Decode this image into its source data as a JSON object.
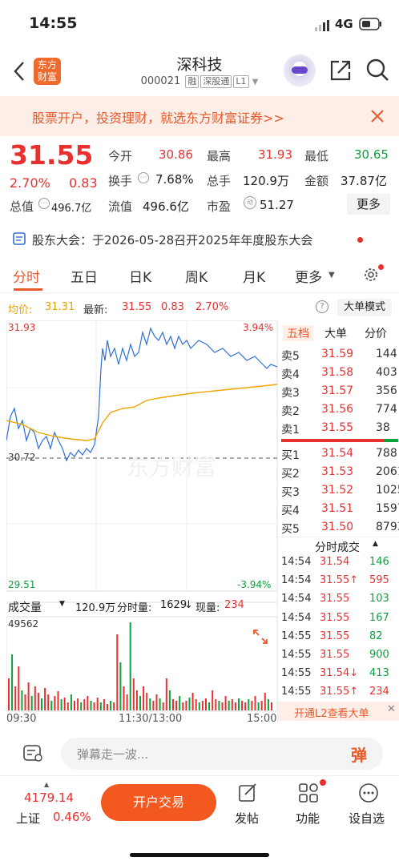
{
  "status": {
    "time": "14:55",
    "network": "4G"
  },
  "header": {
    "title": "深科技",
    "code": "000021",
    "tags": [
      "融",
      "深股通",
      "L1"
    ]
  },
  "banner": {
    "text": "股票开户，投资理财，就选东方财富证券>>"
  },
  "quote": {
    "price": "31.55",
    "pct": "2.70%",
    "change": "0.83",
    "open_label": "今开",
    "open": "30.86",
    "high_label": "最高",
    "high": "31.93",
    "low_label": "最低",
    "low": "30.65",
    "turnover_label": "换手",
    "turnover": "7.68%",
    "volume_label": "总手",
    "volume": "120.9万",
    "amount_label": "金额",
    "amount": "37.87亿",
    "mktcap_label": "总值",
    "mktcap": "496.7亿",
    "float_label": "流值",
    "float": "496.6亿",
    "pe_label": "市盈",
    "pe": "51.27",
    "more": "更多"
  },
  "notice": {
    "text": "股东大会：于2026-05-28召开2025年年度股东大会"
  },
  "tabs": [
    "分时",
    "五日",
    "日K",
    "周K",
    "月K",
    "更多"
  ],
  "chart_header": {
    "avg_label": "均价:",
    "avg": "31.31",
    "latest_label": "最新:",
    "latest": "31.55",
    "chg": "0.83",
    "pct": "2.70%",
    "bigorder": "大单模式"
  },
  "chart_labels": {
    "top": "31.93",
    "bottom": "29.51",
    "top_pct": "3.94%",
    "bottom_pct": "-3.94%",
    "ref": "30.72",
    "watermark": "东方财富"
  },
  "volume_header": {
    "label": "成交量",
    "total": "120.9万",
    "min_label": "分时量:",
    "min_vol": "1629",
    "now_label": "现量:",
    "now_vol": "234",
    "max": "49562"
  },
  "time_axis": [
    "09:30",
    "11:30/13:00",
    "15:00"
  ],
  "orderbook": {
    "tabs": [
      "五档",
      "大单",
      "分价"
    ],
    "asks": [
      [
        "卖5",
        "31.59",
        "144"
      ],
      [
        "卖4",
        "31.58",
        "403"
      ],
      [
        "卖3",
        "31.57",
        "356"
      ],
      [
        "卖2",
        "31.56",
        "774"
      ],
      [
        "卖1",
        "31.55",
        "38"
      ]
    ],
    "bids": [
      [
        "买1",
        "31.54",
        "788"
      ],
      [
        "买2",
        "31.53",
        "2061"
      ],
      [
        "买3",
        "31.52",
        "1025"
      ],
      [
        "买4",
        "31.51",
        "1597"
      ],
      [
        "买5",
        "31.50",
        "8793"
      ]
    ]
  },
  "trades": {
    "title": "分时成交",
    "rows": [
      [
        "14:54",
        "31.54",
        "146",
        "g",
        ""
      ],
      [
        "14:54",
        "31.55↑",
        "595",
        "r",
        ""
      ],
      [
        "14:54",
        "31.55",
        "103",
        "g",
        ""
      ],
      [
        "14:54",
        "31.55",
        "167",
        "g",
        ""
      ],
      [
        "14:55",
        "31.55",
        "82",
        "g",
        ""
      ],
      [
        "14:55",
        "31.55",
        "900",
        "g",
        ""
      ],
      [
        "14:55",
        "31.54↓",
        "413",
        "g",
        ""
      ],
      [
        "14:55",
        "31.55↑",
        "234",
        "r",
        ""
      ]
    ],
    "l2": "开通L2查看大单"
  },
  "comment": {
    "placeholder": "弹幕走一波...",
    "btn": "弹"
  },
  "bottom": {
    "index_value": "4179.14",
    "index_name": "上证",
    "index_pct": "0.46%",
    "trade": "开户交易",
    "post": "发帖",
    "func": "功能",
    "custom": "设自选"
  }
}
